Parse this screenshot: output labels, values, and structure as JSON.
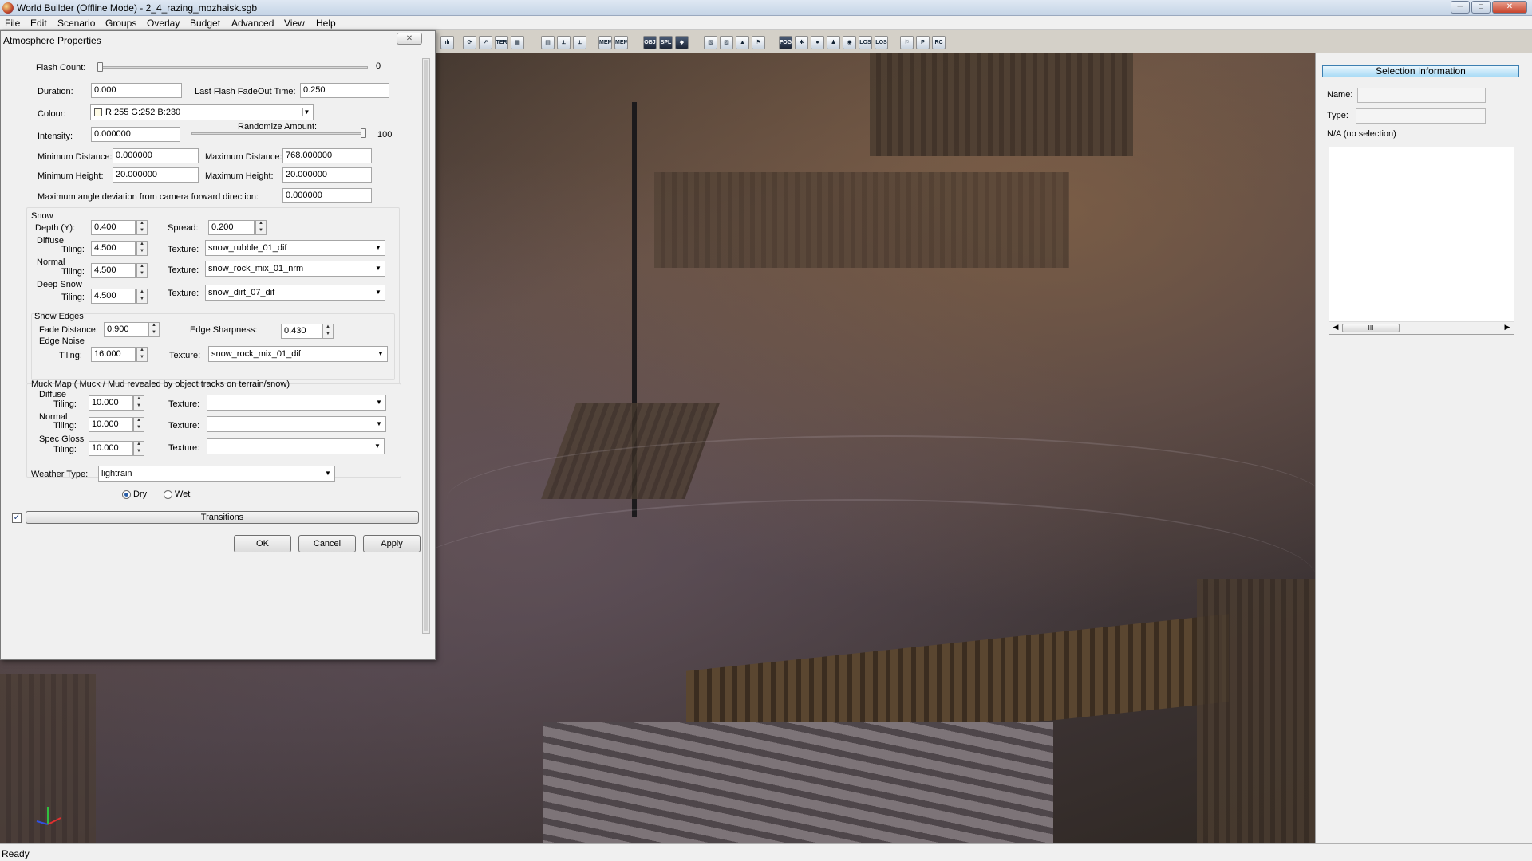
{
  "window": {
    "title": "World Builder (Offline Mode) - 2_4_razing_mozhaisk.sgb",
    "min": "─",
    "max": "□",
    "close": "✕"
  },
  "menu": [
    "File",
    "Edit",
    "Scenario",
    "Groups",
    "Overlay",
    "Budget",
    "Advanced",
    "View",
    "Help"
  ],
  "toolbar": [
    "ılı",
    "⟳",
    "↗",
    "TER",
    "▦",
    "▤",
    "⟂",
    "⟂",
    "MEM",
    "MEM",
    "OBJ",
    "SPL",
    "◆",
    "▧",
    "▨",
    "▲",
    "⚑",
    "FOG",
    "✱",
    "●",
    "♟",
    "◉",
    "LOS",
    "LOS",
    "⚐",
    "P",
    "RC"
  ],
  "dialog": {
    "title": "Atmosphere Properties",
    "close": "✕",
    "flash_count_label": "Flash Count:",
    "flash_count_value": "0",
    "duration_label": "Duration:",
    "duration_value": "0.000",
    "last_flash_label": "Last Flash FadeOut Time:",
    "last_flash_value": "0.250",
    "colour_label": "Colour:",
    "colour_value": "R:255 G:252 B:230",
    "intensity_label": "Intensity:",
    "intensity_value": "0.000000",
    "randomize_label": "Randomize Amount:",
    "randomize_value": "100",
    "min_distance_label": "Minimum Distance:",
    "min_distance_value": "0.000000",
    "max_distance_label": "Maximum Distance:",
    "max_distance_value": "768.000000",
    "min_height_label": "Minimum Height:",
    "min_height_value": "20.000000",
    "max_height_label": "Maximum Height:",
    "max_height_value": "20.000000",
    "max_angle_label": "Maximum angle deviation from camera forward direction:",
    "max_angle_value": "0.000000",
    "snow": {
      "title": "Snow",
      "depth_label": "Depth (Y):",
      "depth_value": "0.400",
      "spread_label": "Spread:",
      "spread_value": "0.200",
      "diffuse_label": "Diffuse",
      "normal_label": "Normal",
      "deep_label": "Deep Snow",
      "tiling_label": "Tiling:",
      "texture_label": "Texture:",
      "diffuse_tiling": "4.500",
      "diffuse_texture": "snow_rubble_01_dif",
      "normal_tiling": "4.500",
      "normal_texture": "snow_rock_mix_01_nrm",
      "deep_tiling": "4.500",
      "deep_texture": "snow_dirt_07_dif"
    },
    "edges": {
      "title": "Snow Edges",
      "fade_label": "Fade Distance:",
      "fade_value": "0.900",
      "sharp_label": "Edge Sharpness:",
      "sharp_value": "0.430",
      "noise_label": "Edge Noise",
      "tiling_label": "Tiling:",
      "tiling_value": "16.000",
      "texture_label": "Texture:",
      "texture_value": "snow_rock_mix_01_dif"
    },
    "muck": {
      "title": "Muck Map ( Muck / Mud revealed by object tracks on terrain/snow)",
      "diffuse_label": "Diffuse",
      "normal_label": "Normal",
      "spec_label": "Spec Gloss",
      "tiling_label": "Tiling:",
      "texture_label": "Texture:",
      "diffuse_tiling": "10.000",
      "normal_tiling": "10.000",
      "spec_tiling": "10.000",
      "diffuse_texture": "",
      "normal_texture": "",
      "spec_texture": ""
    },
    "weather_label": "Weather Type:",
    "weather_value": "lightrain",
    "dry_label": "Dry",
    "wet_label": "Wet",
    "surface_selected": "Dry",
    "transitions_checked": true,
    "transitions_label": "Transitions",
    "ok_label": "OK",
    "cancel_label": "Cancel",
    "apply_label": "Apply"
  },
  "selection": {
    "header": "Selection Information",
    "name_label": "Name:",
    "type_label": "Type:",
    "status": "N/A (no selection)",
    "scroll_thumb": "III"
  },
  "status": "Ready",
  "colors": {
    "selection_header": "#a9dbf6",
    "swatch": "#fffce6"
  }
}
